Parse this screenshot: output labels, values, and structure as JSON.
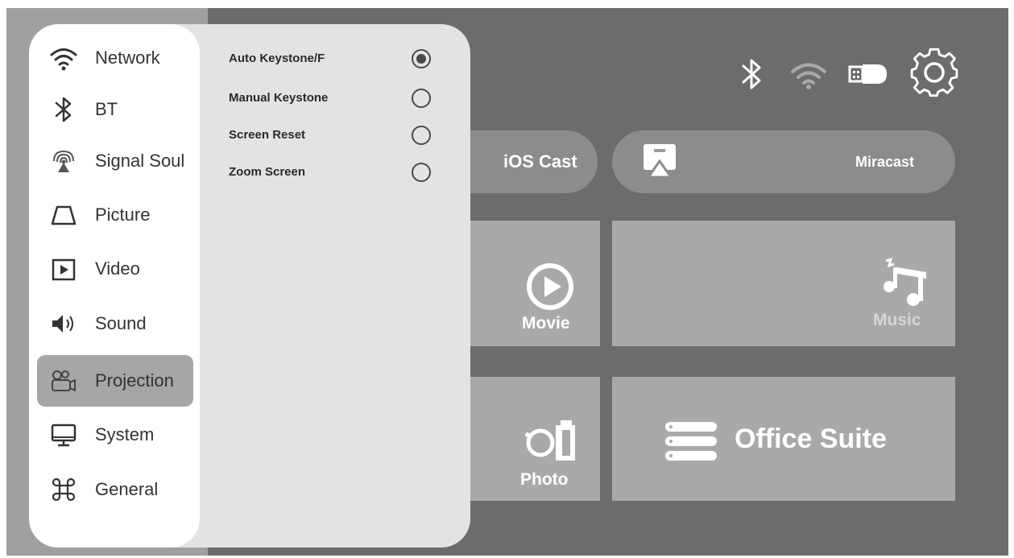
{
  "status_bar": {
    "icons": [
      "bluetooth-icon",
      "wifi-icon",
      "usb-drive-icon",
      "settings-gear-icon"
    ]
  },
  "cast": {
    "ios_cast_label": "iOS Cast",
    "miracast_label": "Miracast"
  },
  "tiles": {
    "movie_label": "Movie",
    "music_label": "Music",
    "photo_label": "Photo",
    "office_label": "Office Suite"
  },
  "menu": {
    "selected": "Projection",
    "items": [
      {
        "label": "Network",
        "icon": "wifi-icon"
      },
      {
        "label": "BT",
        "icon": "bluetooth-icon"
      },
      {
        "label": "Signal Soul",
        "icon": "signal-source-icon"
      },
      {
        "label": "Picture",
        "icon": "picture-icon"
      },
      {
        "label": "Video",
        "icon": "video-play-icon"
      },
      {
        "label": "Sound",
        "icon": "speaker-icon"
      },
      {
        "label": "Projection",
        "icon": "projector-icon"
      },
      {
        "label": "System",
        "icon": "monitor-icon"
      },
      {
        "label": "General",
        "icon": "command-icon"
      }
    ]
  },
  "projection_options": [
    {
      "label": "Auto Keystone/F",
      "checked": true
    },
    {
      "label": "Manual Keystone",
      "checked": false
    },
    {
      "label": "Screen Reset",
      "checked": false
    },
    {
      "label": "Zoom Screen",
      "checked": false
    }
  ],
  "colors": {
    "background": "#6c6c6c",
    "tile": "#a9a9a9",
    "pill": "#8c8c8c",
    "menu_panel": "#e3e3e3",
    "menu_sidebar": "#ffffff",
    "menu_selected": "#a6a6a6"
  }
}
